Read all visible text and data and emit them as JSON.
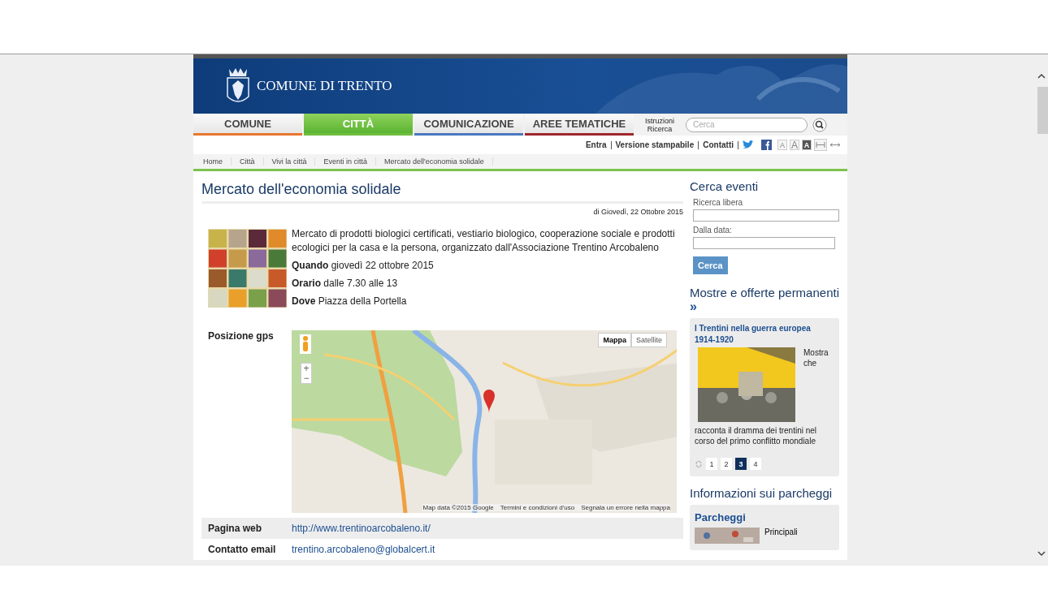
{
  "header": {
    "title": "COMUNE DI TRENTO"
  },
  "nav": [
    {
      "label": "COMUNE",
      "selected": false,
      "color": "#e8772e"
    },
    {
      "label": "CITTÀ",
      "selected": true,
      "color": "#6fbf3f"
    },
    {
      "label": "COMUNICAZIONE",
      "selected": false,
      "color": "#4a78c0"
    },
    {
      "label": "AREE TEMATICHE",
      "selected": false,
      "color": "#a0262c"
    }
  ],
  "search_help": "Istruzioni Ricerca",
  "search": {
    "placeholder": "Cerca"
  },
  "utility_links": [
    "Entra",
    "Versione stampabile",
    "Contatti"
  ],
  "font_sizes": [
    {
      "label": "A",
      "selected": false
    },
    {
      "label": "A",
      "selected": false
    },
    {
      "label": "A",
      "selected": true
    }
  ],
  "breadcrumb": [
    "Home",
    "Città",
    "Vivi la città",
    "Eventi in città",
    "Mercato dell'economia solidale"
  ],
  "article": {
    "title": "Mercato dell'economia solidale",
    "date": "di Giovedì, 22 Ottobre 2015",
    "description": "Mercato di prodotti biologici certificati, vestiario biologico, cooperazione sociale e prodotti ecologici per la casa e la persona, organizzato dall'Associazione Trentino Arcobaleno",
    "details": [
      "**Quando** giovedì 22 ottobre 2015",
      "**Orario** dalle 7.30 alle 13",
      "**Dove** Piazza della Portella"
    ],
    "info_rows": [
      {
        "label": "Posizione gps",
        "kind": "map",
        "map_types": [
          {
            "label": "Mappa",
            "selected": true
          },
          {
            "label": "Satellite",
            "selected": false
          }
        ],
        "zoom": [
          "+",
          "−"
        ],
        "attribution": [
          "Map data ©2015 Google",
          "Termini e condizioni d'uso",
          "Segnala un errore nella mappa"
        ]
      },
      {
        "label": "Pagina web",
        "kind": "link",
        "value": "http://www.trentinoarcobaleno.it/"
      },
      {
        "label": "Contatto email",
        "kind": "link",
        "value": "trentino.arcobaleno@globalcert.it"
      }
    ]
  },
  "sidebar": {
    "event_search": {
      "title": "Cerca eventi",
      "fields": [
        {
          "label": "Ricerca libera"
        },
        {
          "label": "Dalla data:"
        }
      ],
      "button": "Cerca"
    },
    "exhibits": {
      "title": "Mostre e offerte permanenti",
      "more": "»",
      "item_title": "I Trentini nella guerra europea 1914-1920",
      "text": "Mostra che racconta il dramma dei trentini nel corso del primo conflitto mondiale",
      "pages": [
        {
          "label": "1",
          "selected": false
        },
        {
          "label": "2",
          "selected": false
        },
        {
          "label": "3",
          "selected": true
        },
        {
          "label": "4",
          "selected": false
        }
      ]
    },
    "parking": {
      "title": "Informazioni sui parcheggi",
      "item_title": "Parcheggi",
      "text": "Principali"
    }
  }
}
